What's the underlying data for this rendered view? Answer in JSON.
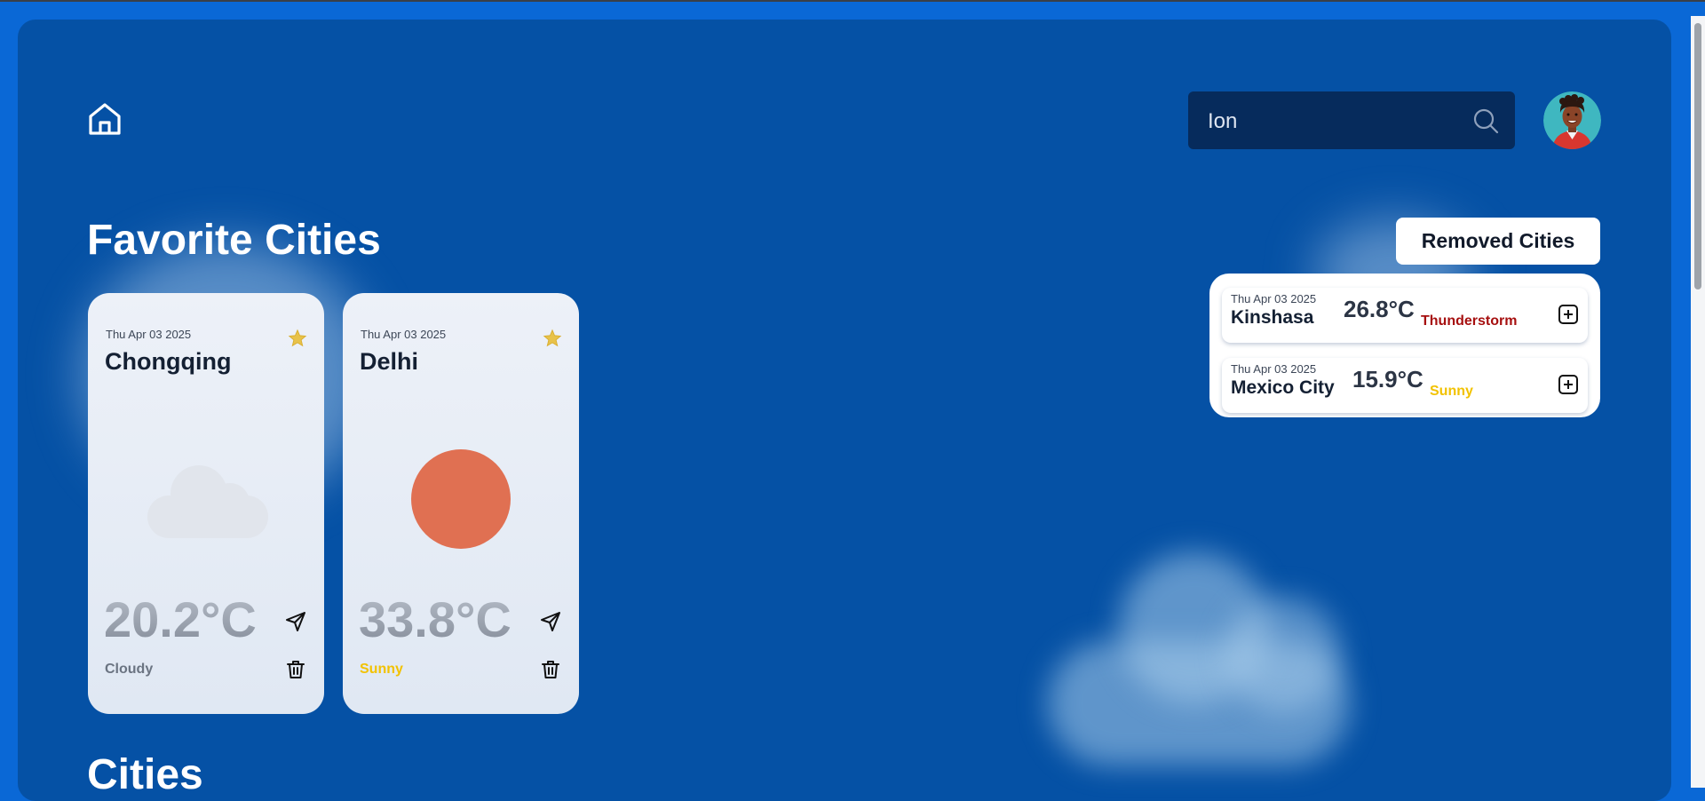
{
  "search": {
    "value": "Ion"
  },
  "sections": {
    "favorites_title": "Favorite Cities",
    "cities_title": "Cities"
  },
  "favorites": [
    {
      "date": "Thu Apr 03 2025",
      "city": "Chongqing",
      "temp": "20.2°C",
      "condition": "Cloudy",
      "condition_color": "#6b7482",
      "icon": "cloud-icon"
    },
    {
      "date": "Thu Apr 03 2025",
      "city": "Delhi",
      "temp": "33.8°C",
      "condition": "Sunny",
      "condition_color": "#f2c200",
      "icon": "sun-icon"
    }
  ],
  "removed": {
    "button_label": "Removed Cities",
    "items": [
      {
        "date": "Thu Apr 03 2025",
        "city": "Kinshasa",
        "temp": "26.8°C",
        "condition": "Thunderstorm",
        "condition_color": "#a60f0f"
      },
      {
        "date": "Thu Apr 03 2025",
        "city": "Mexico City",
        "temp": "15.9°C",
        "condition": "Sunny",
        "condition_color": "#f2c200"
      }
    ]
  },
  "colors": {
    "background": "#0551a5",
    "outer": "#0a68d6",
    "search_bg": "#062b5c",
    "star": "#e8c24a",
    "sun": "#e07052"
  }
}
